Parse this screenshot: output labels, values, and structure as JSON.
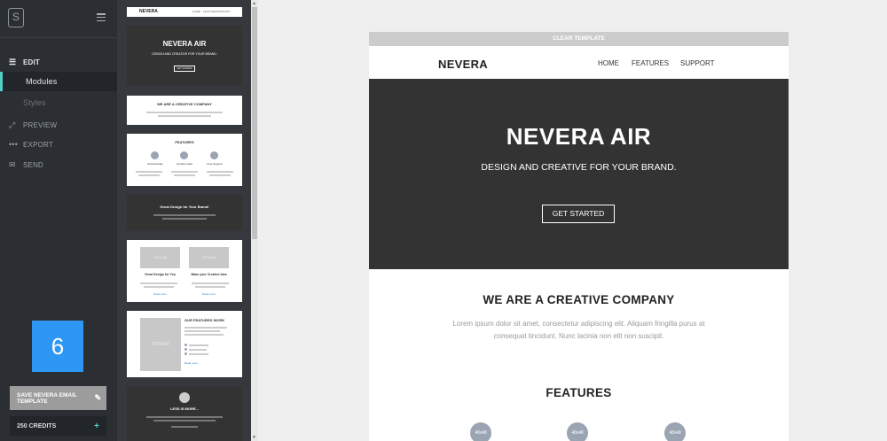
{
  "sidebar": {
    "logo_letter": "S",
    "nav": {
      "edit": "EDIT",
      "modules": "Modules",
      "styles": "Styles",
      "preview": "PREVIEW",
      "export": "EXPORT",
      "send": "SEND"
    },
    "badge": "6",
    "save_button": "SAVE NEVERA EMAIL TEMPLATE",
    "credits": "250 CREDITS",
    "accent_color": "#4fd1c5",
    "badge_color": "#2d97f3"
  },
  "module_thumbnails": {
    "nav": {
      "brand": "NEVERA",
      "links": [
        "HOME",
        "FEATURES",
        "SUPPORT"
      ]
    },
    "hero": {
      "title": "NEVERA AIR",
      "subtitle": "DESIGN AND CREATIVE FOR YOUR BRAND.",
      "button": "GET STARTED"
    },
    "about": {
      "title": "WE ARE A CREATIVE COMPANY"
    },
    "features": {
      "title": "FEATURES",
      "items": [
        "Great Design",
        "Creative Idea",
        "Free Support"
      ]
    },
    "banner": {
      "title": "Great Design for Your Brand!"
    },
    "two_col": {
      "placeholder": "270x150",
      "items": [
        "Great Design for You",
        "Make your Creative Idea"
      ],
      "link": "Read more"
    },
    "work": {
      "title": "OUR FEATURED WORK",
      "placeholder": "270x350"
    },
    "quote": {
      "title": "LESS IS MORE..."
    }
  },
  "email": {
    "clear_label": "CLEAR TEMPLATE",
    "brand": "NEVERA",
    "menu": [
      "HOME",
      "FEATURES",
      "SUPPORT"
    ],
    "hero": {
      "title": "NEVERA AIR",
      "subtitle": "DESIGN AND CREATIVE FOR YOUR BRAND.",
      "button": "GET STARTED"
    },
    "about": {
      "title": "WE ARE A CREATIVE COMPANY",
      "text": "Lorem ipsum dolor sit amet, consectetur adipiscing elit. Aliquam fringilla purus at consequat tincidunt. Nunc lacinia non elit non suscipit."
    },
    "features": {
      "title": "FEATURES",
      "icon_placeholders": [
        "48x48",
        "48x48",
        "48x48"
      ]
    }
  }
}
